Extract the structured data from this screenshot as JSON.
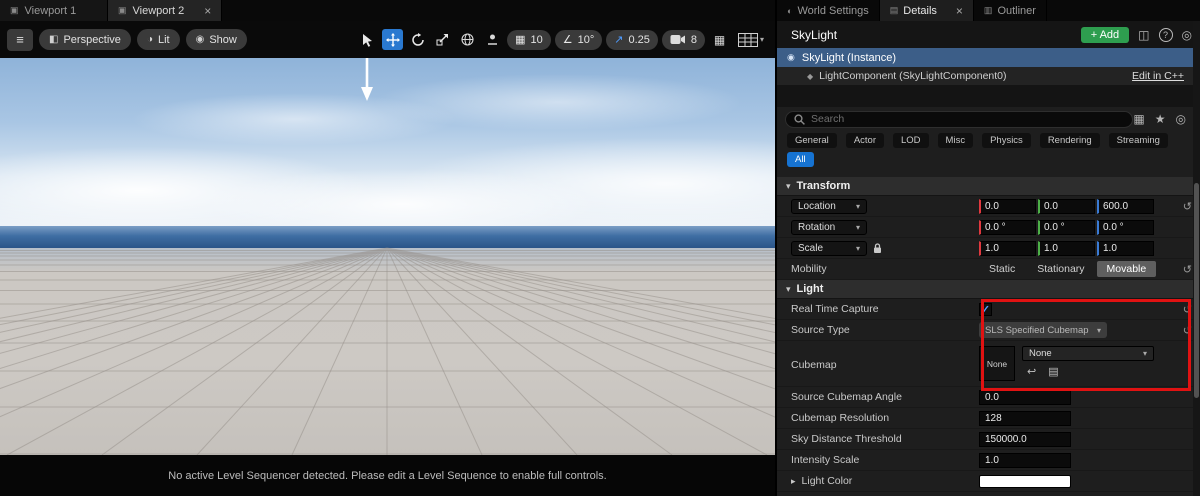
{
  "icons": {
    "caret_down": "▾",
    "caret_right": "▸",
    "menu": "≡",
    "check": "✓",
    "reset": "↺",
    "star": "★",
    "grid": "▦",
    "angle": "∠",
    "arrow_ne": "↗",
    "help": "?",
    "panels": "◫",
    "world": "◐",
    "lit_sphere": "◑",
    "eye": "◉",
    "doc": "▤",
    "list": "▥",
    "viewport": "▣",
    "perspective": "◧",
    "instance": "◉",
    "component": "◆",
    "gear": "◎",
    "use_asset": "↩",
    "browse": "▤"
  },
  "viewport": {
    "tabs": [
      {
        "label": "Viewport 1"
      },
      {
        "label": "Viewport 2",
        "close_label": "×"
      }
    ],
    "toolbar": {
      "perspective_label": "Perspective",
      "lit_label": "Lit",
      "show_label": "Show",
      "grid_snap_value": "10",
      "rotation_snap_value": "10°",
      "scale_snap_value": "0.25",
      "camera_speed_value": "8"
    },
    "status_message": "No active Level Sequencer detected. Please edit a Level Sequence to enable full controls."
  },
  "details": {
    "tabs": [
      {
        "label": "World Settings"
      },
      {
        "label": "Details",
        "close_label": "×"
      },
      {
        "label": "Outliner"
      }
    ],
    "header": {
      "title": "SkyLight",
      "add_label": "+ Add"
    },
    "instance_label": "SkyLight (Instance)",
    "component_label": "LightComponent (SkyLightComponent0)",
    "edit_cpp_label": "Edit in C++",
    "search_placeholder": "Search",
    "filters": [
      "General",
      "Actor",
      "LOD",
      "Misc",
      "Physics",
      "Rendering",
      "Streaming"
    ],
    "all_filter_label": "All",
    "transform": {
      "section_label": "Transform",
      "location": {
        "label": "Location",
        "x": "0.0",
        "y": "0.0",
        "z": "600.0"
      },
      "rotation": {
        "label": "Rotation",
        "x": "0.0 °",
        "y": "0.0 °",
        "z": "0.0 °"
      },
      "scale": {
        "label": "Scale",
        "x": "1.0",
        "y": "1.0",
        "z": "1.0"
      },
      "mobility": {
        "label": "Mobility",
        "options": [
          "Static",
          "Stationary",
          "Movable"
        ],
        "selected": "Movable"
      }
    },
    "light": {
      "section_label": "Light",
      "real_time_capture_label": "Real Time Capture",
      "real_time_capture_checked": true,
      "source_type_label": "Source Type",
      "source_type_value": "SLS Specified Cubemap",
      "cubemap_label": "Cubemap",
      "cubemap_thumb_label": "None",
      "cubemap_value": "None",
      "source_cubemap_angle_label": "Source Cubemap Angle",
      "source_cubemap_angle_value": "0.0",
      "cubemap_resolution_label": "Cubemap Resolution",
      "cubemap_resolution_value": "128",
      "sky_distance_threshold_label": "Sky Distance Threshold",
      "sky_distance_threshold_value": "150000.0",
      "intensity_scale_label": "Intensity Scale",
      "intensity_scale_value": "1.0",
      "light_color_label": "Light Color"
    },
    "colors": {
      "axis_x": "#e0393f",
      "axis_y": "#4db048",
      "axis_z": "#3a7bd5",
      "selection_blue": "#3c5e88",
      "accent_blue": "#1673d2",
      "add_green": "#2e9e4f",
      "annotation_red": "#e01212"
    }
  }
}
